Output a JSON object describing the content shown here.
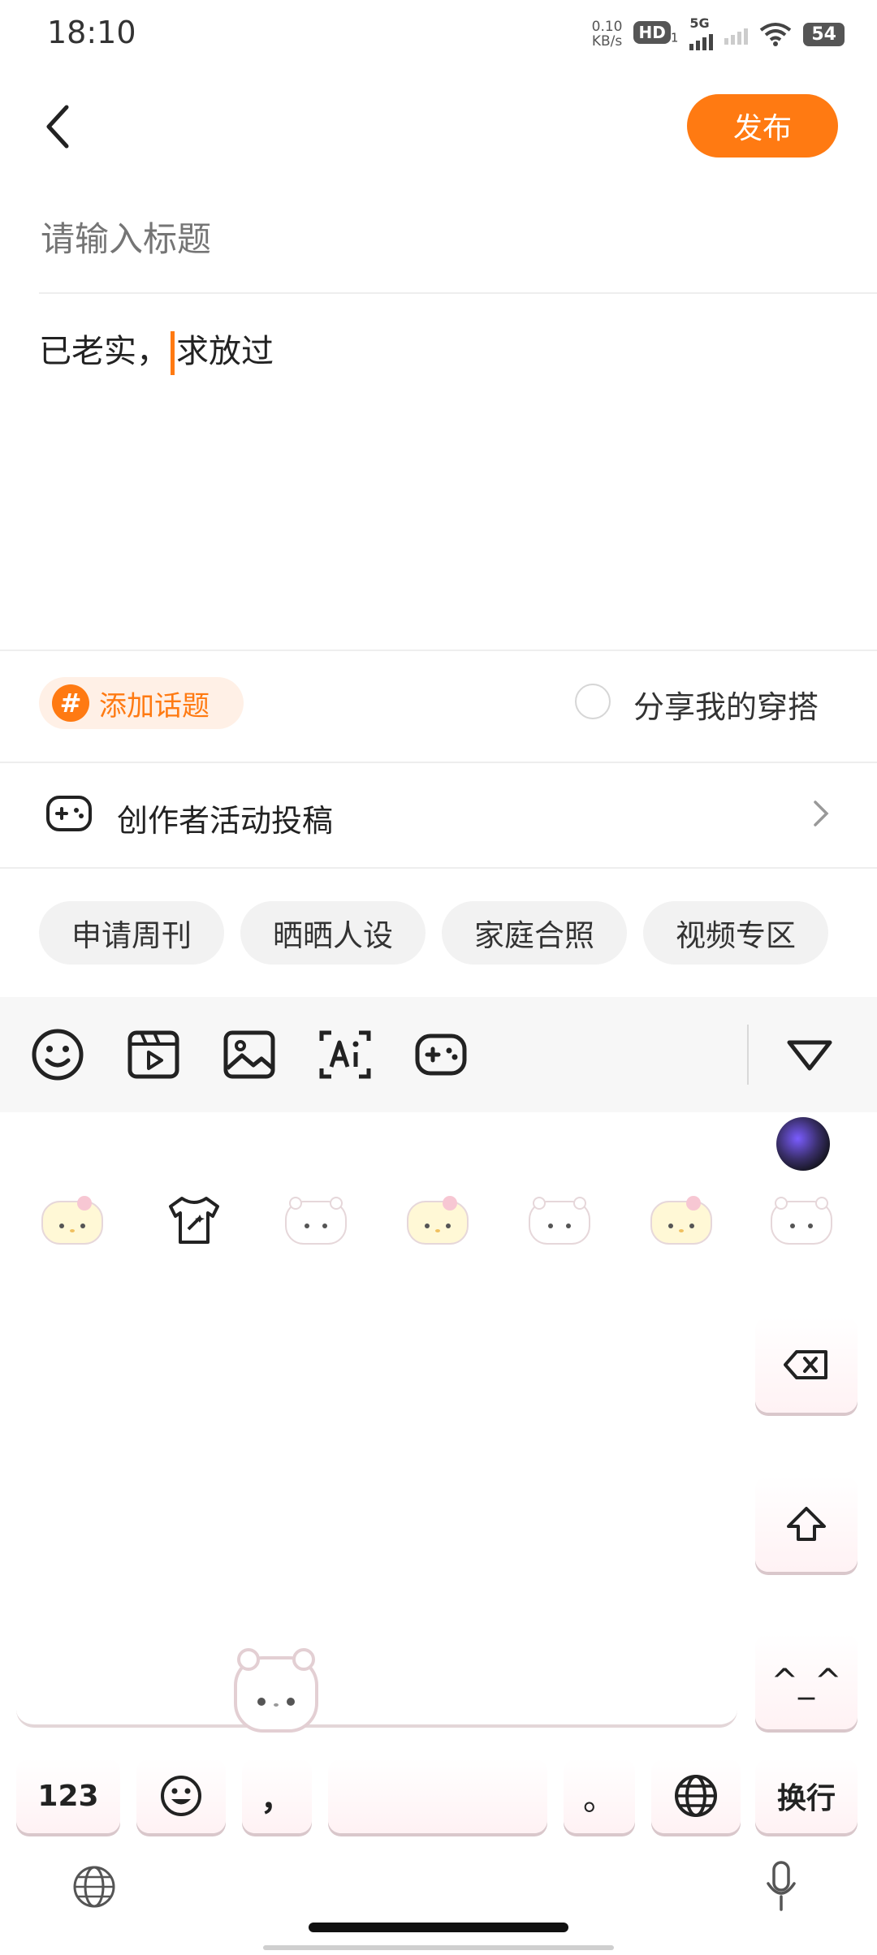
{
  "status_bar": {
    "time": "18:10",
    "net_speed_value": "0.10",
    "net_speed_unit": "KB/s",
    "hd_label": "HD",
    "hd_sub": "1",
    "network_type": "5G",
    "battery": "54"
  },
  "header": {
    "publish_label": "发布"
  },
  "editor": {
    "title_placeholder": "请输入标题",
    "body_before_cursor": "已老实，",
    "body_after_cursor": "求放过"
  },
  "options": {
    "add_topic_label": "添加话题",
    "share_outfit_label": "分享我的穿搭",
    "creator_activity_label": "创作者活动投稿"
  },
  "topic_chips": [
    "申请周刊",
    "晒晒人设",
    "家庭合照",
    "视频专区"
  ],
  "toolbar": {
    "icons": [
      "emoji-icon",
      "video-icon",
      "image-icon",
      "ai-text-icon",
      "gamepad-icon"
    ]
  },
  "keyboard": {
    "key_123": "123",
    "key_comma": "，",
    "key_period": "。",
    "key_enter": "换行",
    "key_kaomoji": "^_^",
    "accent_color": "#ff7a12"
  }
}
